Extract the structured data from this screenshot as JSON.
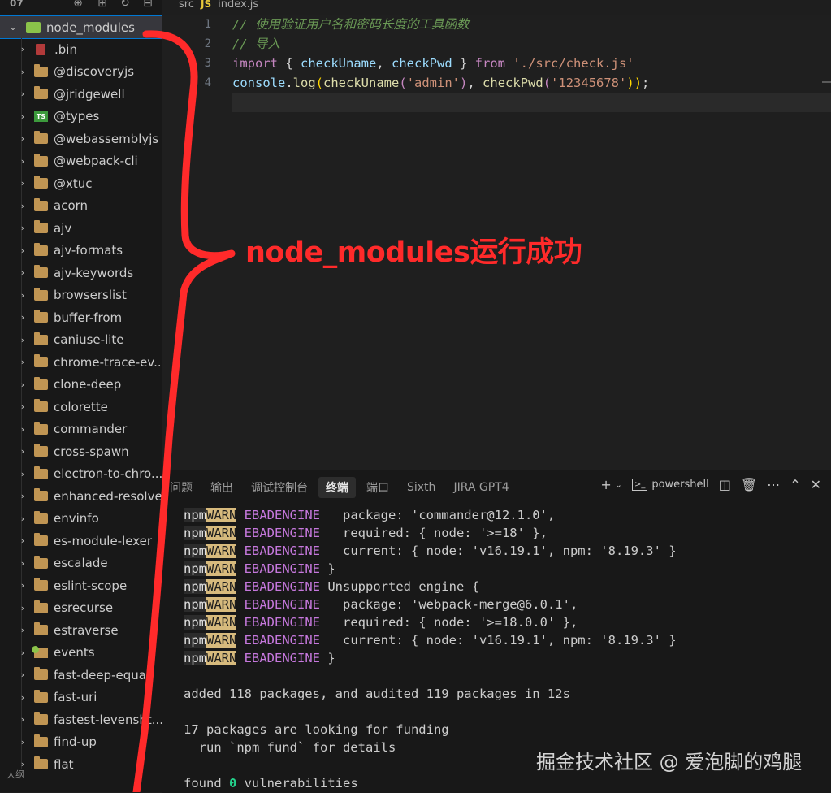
{
  "sidebar": {
    "folder_name": "07",
    "root": "node_modules",
    "items": [
      {
        "label": ".bin",
        "icon": "bin-file-icon"
      },
      {
        "label": "@discoveryjs",
        "icon": "folder-icon"
      },
      {
        "label": "@jridgewell",
        "icon": "folder-icon"
      },
      {
        "label": "@types",
        "icon": "typescript-folder-icon"
      },
      {
        "label": "@webassemblyjs",
        "icon": "folder-icon"
      },
      {
        "label": "@webpack-cli",
        "icon": "folder-icon"
      },
      {
        "label": "@xtuc",
        "icon": "folder-icon"
      },
      {
        "label": "acorn",
        "icon": "folder-icon"
      },
      {
        "label": "ajv",
        "icon": "folder-icon"
      },
      {
        "label": "ajv-formats",
        "icon": "folder-icon"
      },
      {
        "label": "ajv-keywords",
        "icon": "folder-icon"
      },
      {
        "label": "browserslist",
        "icon": "folder-icon"
      },
      {
        "label": "buffer-from",
        "icon": "folder-icon"
      },
      {
        "label": "caniuse-lite",
        "icon": "folder-icon"
      },
      {
        "label": "chrome-trace-ev...",
        "icon": "folder-icon"
      },
      {
        "label": "clone-deep",
        "icon": "folder-icon"
      },
      {
        "label": "colorette",
        "icon": "folder-icon"
      },
      {
        "label": "commander",
        "icon": "folder-icon"
      },
      {
        "label": "cross-spawn",
        "icon": "folder-icon"
      },
      {
        "label": "electron-to-chro...",
        "icon": "folder-icon"
      },
      {
        "label": "enhanced-resolve",
        "icon": "folder-icon"
      },
      {
        "label": "envinfo",
        "icon": "folder-icon"
      },
      {
        "label": "es-module-lexer",
        "icon": "folder-icon"
      },
      {
        "label": "escalade",
        "icon": "folder-icon"
      },
      {
        "label": "eslint-scope",
        "icon": "folder-icon"
      },
      {
        "label": "esrecurse",
        "icon": "folder-icon"
      },
      {
        "label": "estraverse",
        "icon": "folder-icon"
      },
      {
        "label": "events",
        "icon": "events-folder-icon"
      },
      {
        "label": "fast-deep-equal",
        "icon": "folder-icon"
      },
      {
        "label": "fast-uri",
        "icon": "folder-icon"
      },
      {
        "label": "fastest-levensht...",
        "icon": "folder-icon"
      },
      {
        "label": "find-up",
        "icon": "folder-icon"
      },
      {
        "label": "flat",
        "icon": "folder-icon"
      }
    ],
    "outline_label": "大纲"
  },
  "breadcrumb": {
    "folder": "src",
    "file_badge": "JS",
    "file": "index.js"
  },
  "editor": {
    "line_numbers": [
      "1",
      "2",
      "3",
      "4"
    ],
    "lines": {
      "l1": "// 使用验证用户名和密码长度的工具函数",
      "l2": "// 导入",
      "l3": {
        "kw_import": "import",
        "brace_open": " { ",
        "v1": "checkUname",
        "comma": ", ",
        "v2": "checkPwd",
        "brace_close": " } ",
        "kw_from": "from",
        "str": "'./src/check.js'"
      },
      "l4": {
        "obj": "console",
        "dot": ".",
        "fn": "log",
        "p1": "(",
        "f1": "checkUname",
        "p2": "(",
        "s1": "'admin'",
        "p3": ")",
        "c": ", ",
        "f2": "checkPwd",
        "p4": "(",
        "s2": "'12345678'",
        "p5": "))",
        "semi": ";"
      }
    }
  },
  "panel": {
    "tabs": [
      "问题",
      "输出",
      "调试控制台",
      "终端",
      "端口",
      "Sixth",
      "JIRA GPT4"
    ],
    "active_tab": "终端",
    "shell": "powershell",
    "terminal": {
      "warn_lines": [
        {
          "npm": "npm",
          "warn": "WARN",
          "code": "EBADENGINE",
          "text": "   package: 'commander@12.1.0',"
        },
        {
          "npm": "npm",
          "warn": "WARN",
          "code": "EBADENGINE",
          "text": "   required: { node: '>=18' },"
        },
        {
          "npm": "npm",
          "warn": "WARN",
          "code": "EBADENGINE",
          "text": "   current: { node: 'v16.19.1', npm: '8.19.3' }"
        },
        {
          "npm": "npm",
          "warn": "WARN",
          "code": "EBADENGINE",
          "text": " }"
        },
        {
          "npm": "npm",
          "warn": "WARN",
          "code": "EBADENGINE",
          "text": " Unsupported engine {"
        },
        {
          "npm": "npm",
          "warn": "WARN",
          "code": "EBADENGINE",
          "text": "   package: 'webpack-merge@6.0.1',"
        },
        {
          "npm": "npm",
          "warn": "WARN",
          "code": "EBADENGINE",
          "text": "   required: { node: '>=18.0.0' },"
        },
        {
          "npm": "npm",
          "warn": "WARN",
          "code": "EBADENGINE",
          "text": "   current: { node: 'v16.19.1', npm: '8.19.3' }"
        },
        {
          "npm": "npm",
          "warn": "WARN",
          "code": "EBADENGINE",
          "text": " }"
        }
      ],
      "added": "added 118 packages, and audited 119 packages in 12s",
      "funding": "17 packages are looking for funding",
      "fund_hint": "  run `npm fund` for details",
      "found_pre": "found ",
      "found_zero": "0",
      "found_post": " vulnerabilities"
    }
  },
  "annotation": "node_modules运行成功",
  "watermark": "掘金技术社区 @ 爱泡脚的鸡腿",
  "colors": {
    "annotation": "#ff2a2a",
    "warn_bg": "#d7ba7d",
    "accent": "#0078d4"
  }
}
